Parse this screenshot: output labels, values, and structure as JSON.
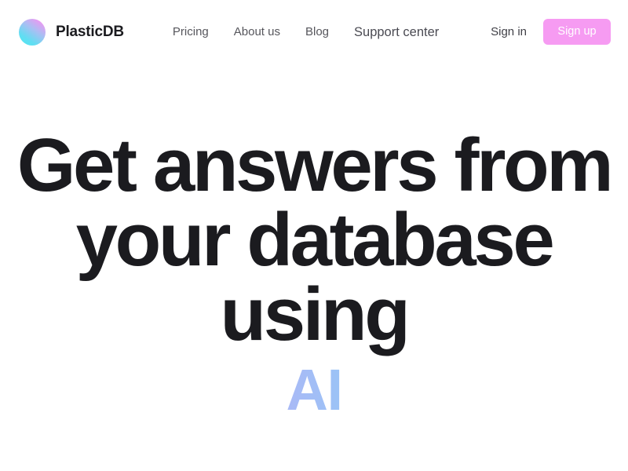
{
  "brand": {
    "name": "PlasticDB",
    "logo_icon": "gradient-circle-icon",
    "logo_gradient_from": "#4FE8F0",
    "logo_gradient_to": "#F49BF0"
  },
  "nav": {
    "links": [
      {
        "label": "Pricing"
      },
      {
        "label": "About us"
      },
      {
        "label": "Blog"
      },
      {
        "label": "Support center"
      }
    ],
    "signin_label": "Sign in",
    "signup_label": "Sign up",
    "signup_bg": "#F69BF2",
    "signup_text_color": "#FFFFFF"
  },
  "hero": {
    "line1": "Get answers from",
    "line2": "your database",
    "line3": "using",
    "accent": "AI",
    "accent_gradient_from": "#E49BF4",
    "accent_gradient_to": "#54E8FB",
    "title_color": "#1B1B1F"
  }
}
